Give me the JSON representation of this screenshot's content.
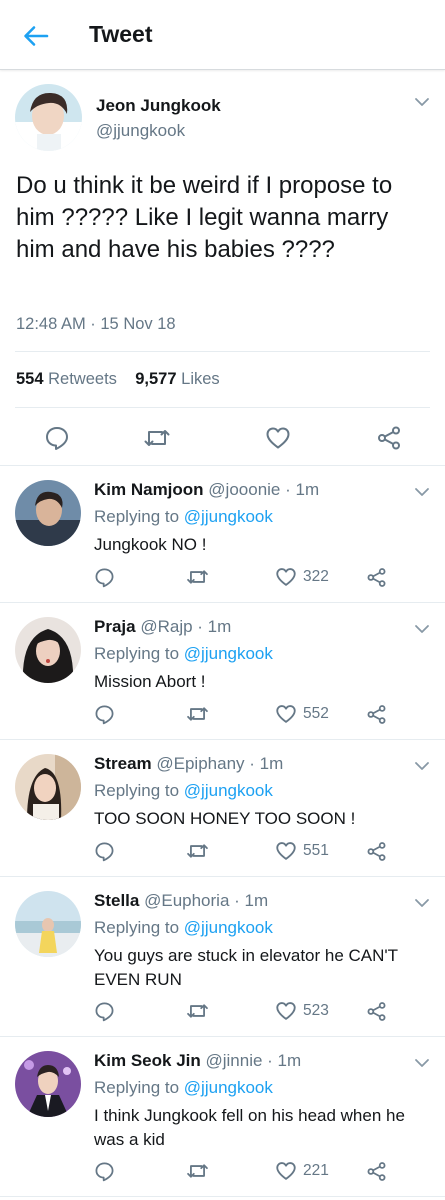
{
  "header": {
    "title": "Tweet",
    "back_icon": "arrow-left-icon"
  },
  "main_tweet": {
    "name": "Jeon Jungkook",
    "handle": "@jjungkook",
    "text": "Do u think it be weird if I propose to him ????? Like I legit wanna marry him and have his babies ????",
    "time": "12:48 AM · 15 Nov 18",
    "retweets_count": "554",
    "retweets_label": "Retweets",
    "likes_count": "9,577",
    "likes_label": "Likes"
  },
  "replies": [
    {
      "name": "Kim Namjoon",
      "meta": "@jooonie · 1m",
      "replying_prefix": "Replying to",
      "replying_handle": "@jjungkook",
      "text": "Jungkook NO !",
      "likes": "322"
    },
    {
      "name": "Praja",
      "meta": "@Rajp · 1m",
      "replying_prefix": "Replying to",
      "replying_handle": "@jjungkook",
      "text": "Mission Abort !",
      "likes": "552"
    },
    {
      "name": "Stream",
      "meta": "@Epiphany · 1m",
      "replying_prefix": "Replying to",
      "replying_handle": "@jjungkook",
      "text": "TOO SOON HONEY TOO SOON !",
      "likes": "551"
    },
    {
      "name": "Stella",
      "meta": "@Euphoria · 1m",
      "replying_prefix": "Replying to",
      "replying_handle": "@jjungkook",
      "text": "You guys are stuck in elevator he CAN'T EVEN RUN",
      "likes": "523"
    },
    {
      "name": "Kim Seok Jin",
      "meta": "@jinnie · 1m",
      "replying_prefix": "Replying to",
      "replying_handle": "@jjungkook",
      "text": "I think Jungkook fell on his head when he was a kid",
      "likes": "221"
    }
  ],
  "colors": {
    "accent": "#1da1f2",
    "text": "#14171a",
    "secondary": "#657786",
    "divider": "#e6ecf0"
  }
}
